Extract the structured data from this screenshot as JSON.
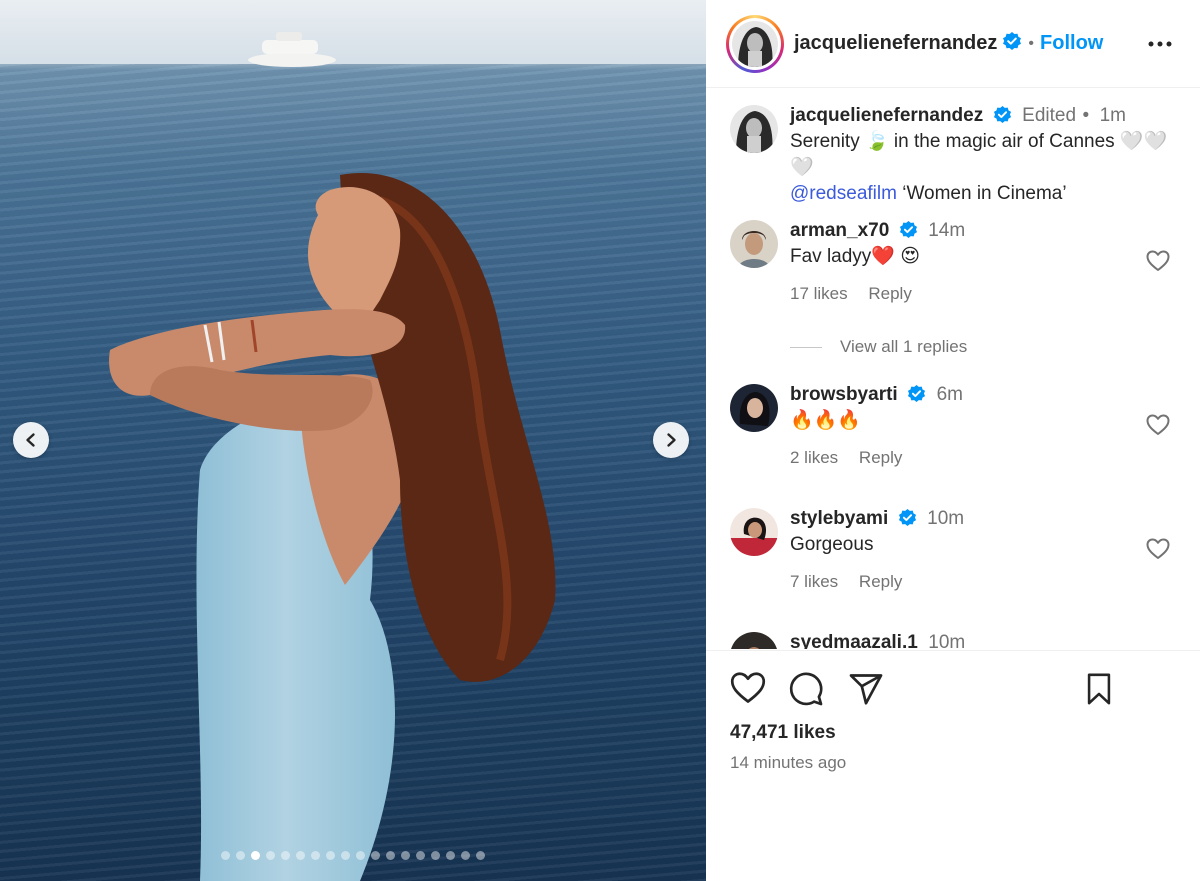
{
  "media": {
    "slide_count": 18,
    "active_slide": 3
  },
  "post_header": {
    "username": "jacquelienefernandez",
    "separator": "•",
    "follow_label": "Follow"
  },
  "caption": {
    "username": "jacquelienefernandez",
    "edited": "Edited",
    "separator": "•",
    "time": "1m",
    "text_part1": "Serenity 🍃 in the magic air of Cannes 🤍🤍🤍",
    "mention": "@redseafilm",
    "text_part2": " ‘Women in Cinema’"
  },
  "comments": [
    {
      "username": "arman_x70",
      "time": "14m",
      "text": "Fav ladyy❤️ 😍",
      "likes": "17 likes",
      "reply": "Reply"
    },
    {
      "username": "browsbyarti",
      "time": "6m",
      "text": "🔥🔥🔥",
      "likes": "2 likes",
      "reply": "Reply"
    },
    {
      "username": "stylebyami",
      "time": "10m",
      "text": "Gorgeous",
      "likes": "7 likes",
      "reply": "Reply"
    },
    {
      "username": "syedmaazali.1",
      "time": "10m"
    }
  ],
  "view_replies": "View all 1 replies",
  "footer": {
    "likes": "47,471 likes",
    "time_ago": "14 minutes ago"
  },
  "colors": {
    "follow_blue": "#0095f6",
    "verified_blue": "#0095f6",
    "mention_blue": "#3b5bdb"
  }
}
